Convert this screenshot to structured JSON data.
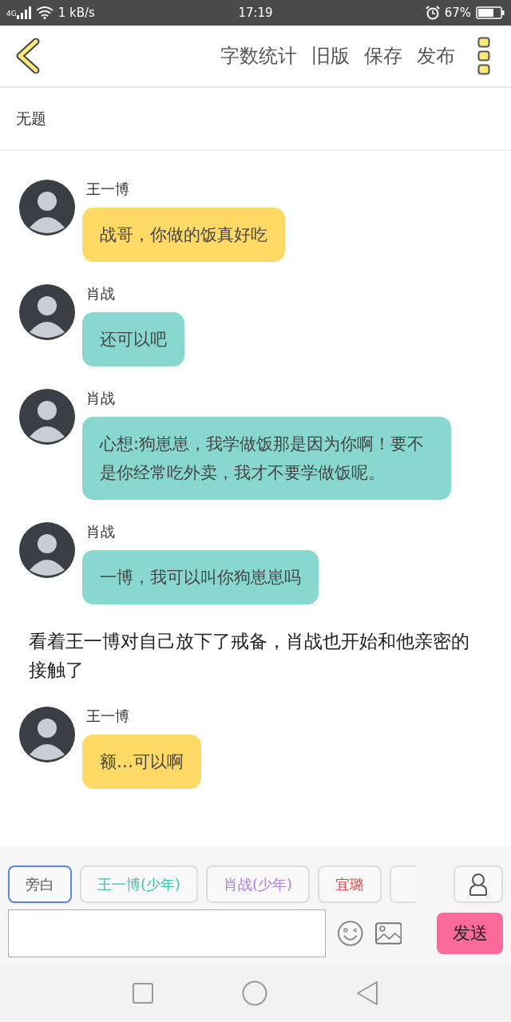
{
  "status_bar": {
    "network": "4G",
    "speed": "1 kB/s",
    "time": "17:19",
    "battery": "67%"
  },
  "toolbar": {
    "actions": [
      "字数统计",
      "旧版",
      "保存",
      "发布"
    ]
  },
  "title": "无题",
  "items": [
    {
      "kind": "message",
      "speaker": "王一博",
      "text": "战哥，你做的饭真好吃",
      "color": "#fed966"
    },
    {
      "kind": "message",
      "speaker": "肖战",
      "text": "还可以吧",
      "color": "#88d8cf"
    },
    {
      "kind": "message",
      "speaker": "肖战",
      "text": "心想:狗崽崽，我学做饭那是因为你啊！要不是你经常吃外卖，我才不要学做饭呢。",
      "color": "#88d8cf"
    },
    {
      "kind": "message",
      "speaker": "肖战",
      "text": "一博，我可以叫你狗崽崽吗",
      "color": "#88d8cf"
    },
    {
      "kind": "narration",
      "text": "看着王一博对自己放下了戒备，肖战也开始和他亲密的接触了"
    },
    {
      "kind": "message",
      "speaker": "王一博",
      "text": "额…可以啊",
      "color": "#fed966"
    }
  ],
  "role_tabs": [
    {
      "label": "旁白",
      "selected": true,
      "color": "#555555"
    },
    {
      "label": "王一博(少年)",
      "selected": false,
      "color": "#3cc4b0"
    },
    {
      "label": "肖战(少年)",
      "selected": false,
      "color": "#b07ee0"
    },
    {
      "label": "宜璐",
      "selected": false,
      "color": "#e04848"
    },
    {
      "selected": false
    }
  ],
  "input": {
    "send": "发送"
  }
}
